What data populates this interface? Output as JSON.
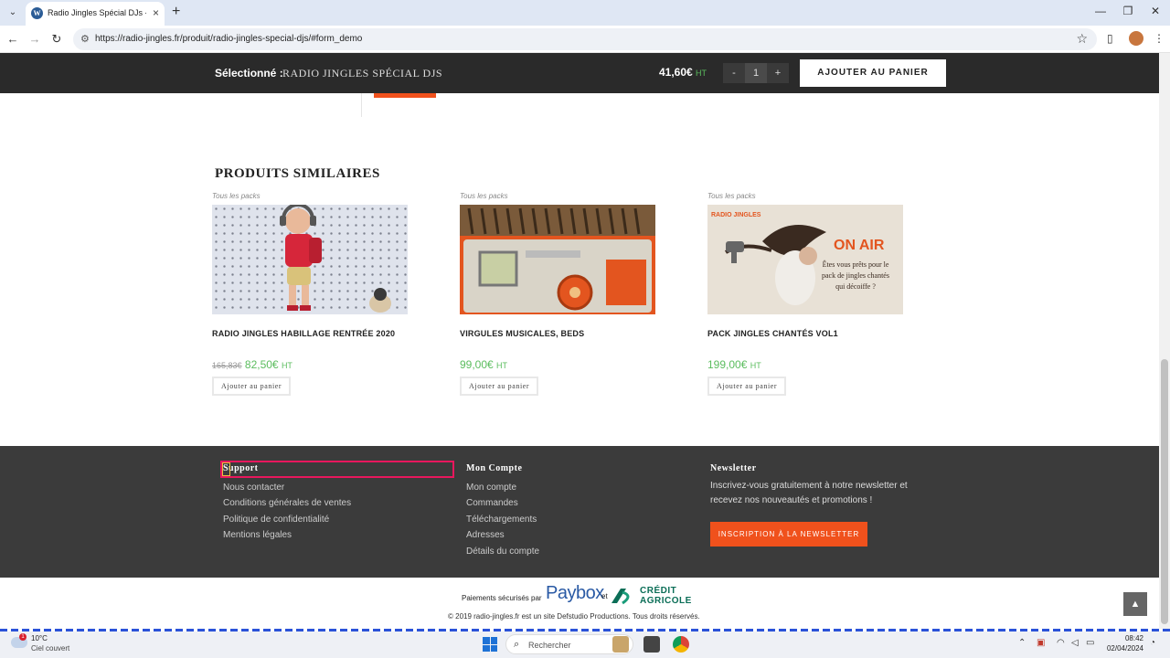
{
  "browser": {
    "tab_title": "Radio Jingles Spécial DJs - Radio",
    "favicon": "W",
    "url": "https://radio-jingles.fr/produit/radio-jingles-special-djs/#form_demo"
  },
  "sticky": {
    "selected_label": "Sélectionné :",
    "selected_name": "RADIO JINGLES SPÉCIAL DJS",
    "price": "41,60€",
    "ht": "HT",
    "minus": "-",
    "qty": "1",
    "plus": "+",
    "add_to_cart": "AJOUTER AU PANIER"
  },
  "similar": {
    "title": "PRODUITS SIMILAIRES",
    "products": [
      {
        "category": "Tous les packs",
        "name": "RADIO JINGLES HABILLAGE RENTRÉE 2020",
        "old_price": "165,83€",
        "price": "82,50€",
        "ht": "HT",
        "button": "Ajouter au panier"
      },
      {
        "category": "Tous les packs",
        "name": "VIRGULES MUSICALES, BEDS",
        "old_price": "",
        "price": "99,00€",
        "ht": "HT",
        "button": "Ajouter au panier"
      },
      {
        "category": "Tous les packs",
        "name": "PACK JINGLES CHANTÉS VOL1",
        "old_price": "",
        "price": "199,00€",
        "ht": "HT",
        "button": "Ajouter au panier",
        "image_text": {
          "brand": "RADIO JINGLES",
          "headline": "ON AIR",
          "line1": "Êtes vous prêts pour le",
          "line2": "pack de jingles chantés",
          "line3": "qui décoiffe ?"
        }
      }
    ]
  },
  "footer": {
    "support": {
      "title": "Support",
      "links": [
        "Nous contacter",
        "Conditions générales de ventes",
        "Politique de confidentialité",
        "Mentions légales"
      ]
    },
    "account": {
      "title": "Mon Compte",
      "links": [
        "Mon compte",
        "Commandes",
        "Téléchargements",
        "Adresses",
        "Détails du compte"
      ]
    },
    "newsletter": {
      "title": "Newsletter",
      "text": "Inscrivez-vous gratuitement à notre newsletter et recevez nos nouveautés et promotions !",
      "button": "INSCRIPTION À LA NEWSLETTER"
    }
  },
  "bottom": {
    "payments": "Paiements sécurisés par",
    "paybox": "Paybox",
    "et": "et",
    "ca_line1": "CRÉDIT",
    "ca_line2": "AGRICOLE",
    "copyright": "© 2019 radio-jingles.fr est un site Defstudio Productions. Tous droits réservés."
  },
  "taskbar": {
    "temp": "10°C",
    "weather": "Ciel couvert",
    "badge": "1",
    "search": "Rechercher",
    "time": "08:42",
    "date": "02/04/2024"
  },
  "colors": {
    "accent": "#f0511c",
    "price_green": "#5bbd5e",
    "dark_bar": "#2a2a2a",
    "footer": "#3b3b3b",
    "highlight": "#e8175d"
  }
}
